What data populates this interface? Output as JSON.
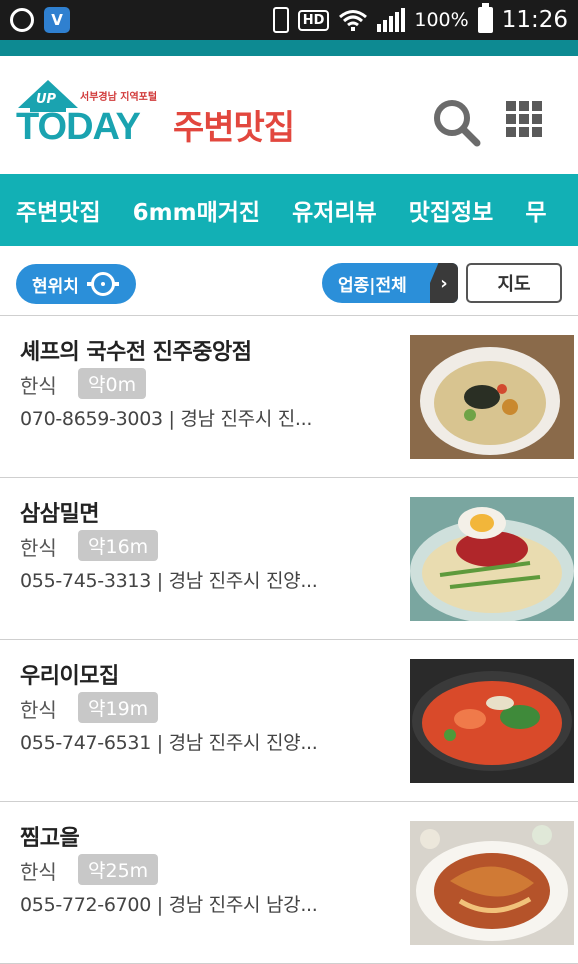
{
  "status_bar": {
    "hd": "HD",
    "battery_pct": "100%",
    "time": "11:26"
  },
  "header": {
    "logo_up": "UP",
    "logo_tagline": "서부경남 지역포털",
    "logo_text": "TODAY",
    "title": "주변맛집",
    "brand_color": "#1aa3b0",
    "title_color": "#e2473e"
  },
  "tabs": [
    "주변맛집",
    "6mm매거진",
    "유저리뷰",
    "맛집정보",
    "무"
  ],
  "filters": {
    "location": "현위치",
    "category": "업종|전체",
    "map": "지도"
  },
  "items": [
    {
      "name": "셰프의 국수전 진주중앙점",
      "type": "한식",
      "distance": "약0m",
      "info": "070-8659-3003 | 경남 진주시 진..."
    },
    {
      "name": "삼삼밀면",
      "type": "한식",
      "distance": "약16m",
      "info": "055-745-3313 | 경남 진주시 진양..."
    },
    {
      "name": "우리이모집",
      "type": "한식",
      "distance": "약19m",
      "info": "055-747-6531 | 경남 진주시 진양..."
    },
    {
      "name": "찜고을",
      "type": "한식",
      "distance": "약25m",
      "info": "055-772-6700 | 경남 진주시 남강..."
    }
  ]
}
